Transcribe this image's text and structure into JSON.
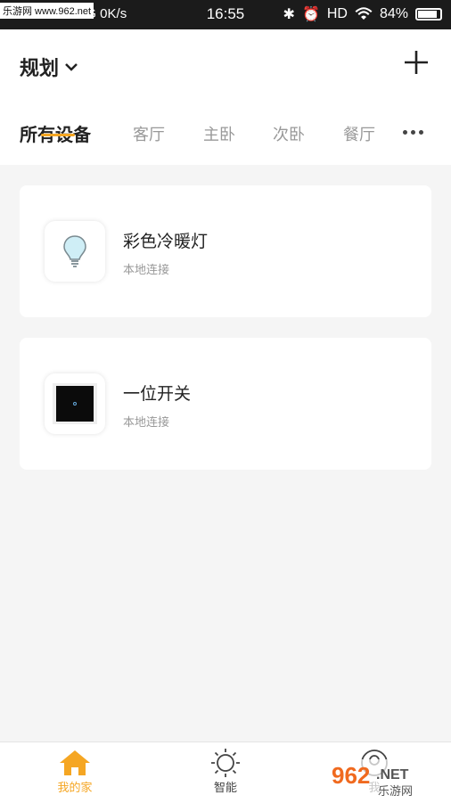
{
  "status_bar": {
    "left_text": "4G  0K/s",
    "time": "16:55",
    "right_text": "HD",
    "battery": "84%"
  },
  "watermark": "乐游网 www.962.net",
  "header": {
    "home_name": "规划",
    "add_icon": "plus-icon"
  },
  "tabs": [
    {
      "label": "所有设备",
      "active": true
    },
    {
      "label": "客厅"
    },
    {
      "label": "主卧"
    },
    {
      "label": "次卧"
    },
    {
      "label": "餐厅"
    }
  ],
  "devices": [
    {
      "name": "彩色冷暖灯",
      "status": "本地连接",
      "icon": "bulb-icon"
    },
    {
      "name": "一位开关",
      "status": "本地连接",
      "icon": "switch-icon"
    }
  ],
  "bottom_nav": [
    {
      "label": "我的家",
      "icon": "home-icon",
      "active": true
    },
    {
      "label": "智能",
      "icon": "sun-icon"
    },
    {
      "label": "我",
      "icon": "user-icon"
    }
  ],
  "brand_overlay": "962.NET 乐游网",
  "colors": {
    "accent": "#f5a623",
    "background": "#f5f5f5"
  }
}
